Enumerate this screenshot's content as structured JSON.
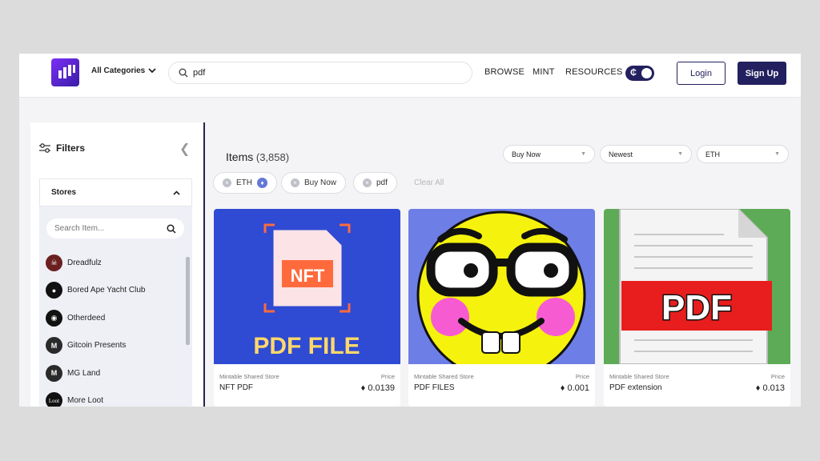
{
  "header": {
    "category": "All Categories",
    "search_value": "pdf",
    "nav": [
      "BROWSE",
      "MINT",
      "RESOURCES"
    ],
    "login": "Login",
    "signup": "Sign Up"
  },
  "sidebar": {
    "title": "Filters",
    "section": "Stores",
    "search_placeholder": "Search Item...",
    "stores": [
      {
        "name": "Dreadfulz",
        "icon": "skull-avatar",
        "color": "#5a1f1f"
      },
      {
        "name": "Bored Ape Yacht Club",
        "icon": "ape-avatar",
        "color": "#111111"
      },
      {
        "name": "Otherdeed",
        "icon": "otherdeed-avatar",
        "color": "#111111"
      },
      {
        "name": "Gitcoin Presents",
        "icon": "m-avatar",
        "color": "#2a2a2a"
      },
      {
        "name": "MG Land",
        "icon": "m-avatar",
        "color": "#2a2a2a"
      },
      {
        "name": "More Loot",
        "icon": "loot-avatar",
        "color": "#111111",
        "badge": "Loot"
      }
    ]
  },
  "main": {
    "items_label": "Items",
    "items_count": "(3,858)",
    "sorts": [
      "Buy Now",
      "Newest",
      "ETH"
    ],
    "chips": [
      "ETH",
      "Buy Now",
      "pdf"
    ],
    "clear_all": "Clear All",
    "cards": [
      {
        "store": "Mintable Shared Store",
        "price_label": "Price",
        "name": "NFT PDF",
        "price": "0.0139",
        "art_text": "PDF FILE",
        "badge": "NFT"
      },
      {
        "store": "Mintable Shared Store",
        "price_label": "Price",
        "name": "PDF FILES",
        "price": "0.001"
      },
      {
        "store": "Mintable Shared Store",
        "price_label": "Price",
        "name": "PDF extension",
        "price": "0.013",
        "art_text": "PDF"
      }
    ]
  },
  "colors": {
    "brand_dark": "#22205e",
    "page_bg": "#f4f4f6",
    "card1_bg": "#2f4ad3",
    "card2_bg": "#6d7ee6",
    "card3_bg": "#5daa57"
  }
}
